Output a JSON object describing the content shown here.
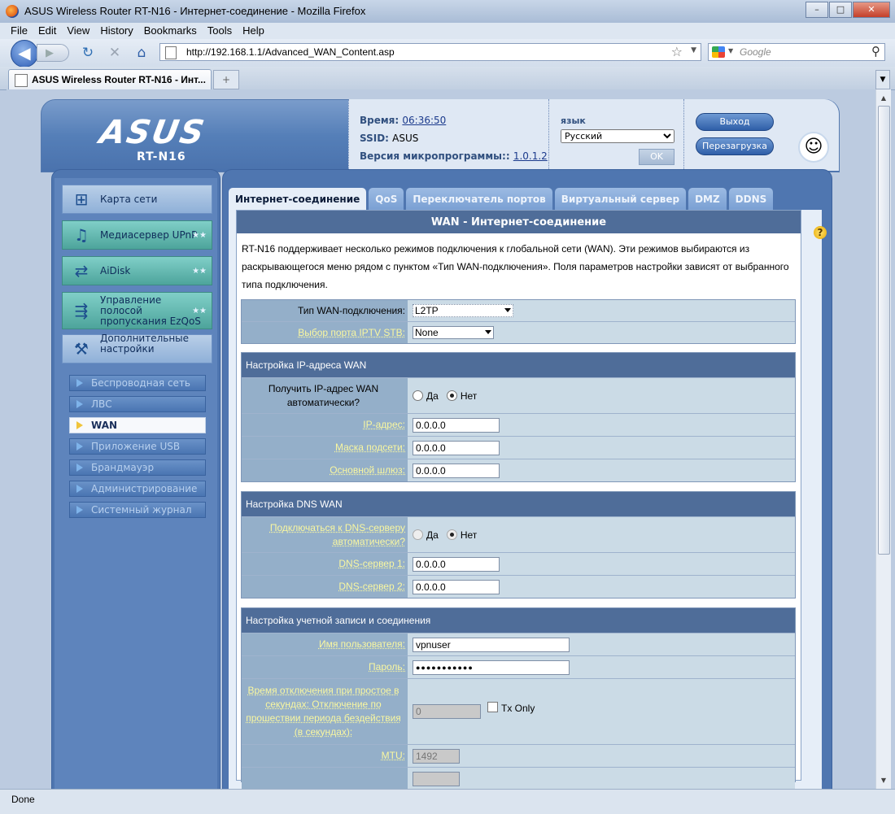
{
  "browser": {
    "window_title": "ASUS Wireless Router RT-N16 - Интернет-соединение - Mozilla Firefox",
    "menu": [
      "File",
      "Edit",
      "View",
      "History",
      "Bookmarks",
      "Tools",
      "Help"
    ],
    "url": "http://192.168.1.1/Advanced_WAN_Content.asp",
    "search_placeholder": "Google",
    "tab_title": "ASUS Wireless Router RT-N16 - Инт...",
    "new_tab": "+",
    "status": "Done"
  },
  "header": {
    "logo": "ASUS",
    "model": "RT-N16",
    "time_label": "Время:",
    "time_value": "06:36:50",
    "ssid_label": "SSID:",
    "ssid_value": "ASUS",
    "fw_label": "Версия микропрограммы::",
    "fw_value": "1.0.1.2",
    "lang_label": "язык",
    "lang_value": "Русский",
    "ok_label": "OK",
    "logout_label": "Выход",
    "reboot_label": "Перезагрузка"
  },
  "sidebar": {
    "menu": [
      {
        "label": "Карта сети",
        "icon": "network-map-icon"
      },
      {
        "label": "Медиасервер UPnP",
        "icon": "media-server-icon"
      },
      {
        "label": "AiDisk",
        "icon": "aidisk-icon"
      },
      {
        "label": "Управление полосой пропускания EzQoS",
        "icon": "ezqos-icon"
      },
      {
        "label": "Дополнительные настройки",
        "icon": "advanced-settings-icon"
      }
    ],
    "stars": "★★",
    "submenu": [
      "Беспроводная сеть",
      "ЛВС",
      "WAN",
      "Приложение USB",
      "Брандмауэр",
      "Администрирование",
      "Системный журнал"
    ],
    "active_submenu": "WAN"
  },
  "tabs": [
    "Интернет-соединение",
    "QoS",
    "Переключатель портов",
    "Виртуальный сервер",
    "DMZ",
    "DDNS"
  ],
  "main": {
    "help_icon": "?",
    "title": "WAN - Интернет-соединение",
    "intro": "RT-N16 поддерживает несколько режимов подключения к глобальной сети (WAN). Эти режимов выбираются из раскрывающегося меню рядом с пунктом «Тип WAN-подключения». Поля параметров настройки зависят от выбранного типа подключения.",
    "wan_type_label": "Тип WAN-подключения:",
    "wan_type_value": "L2TP",
    "iptv_label": "Выбор порта IPTV STB:",
    "iptv_value": "None",
    "ip_section": "Настройка IP-адреса WAN",
    "auto_ip_label": "Получить IP-адрес WAN автоматически?",
    "yes": "Да",
    "no": "Нет",
    "ip_label": "IP-адрес:",
    "ip_value": "0.0.0.0",
    "mask_label": "Маска подсети:",
    "mask_value": "0.0.0.0",
    "gw_label": "Основной шлюз:",
    "gw_value": "0.0.0.0",
    "dns_section": "Настройка DNS WAN",
    "auto_dns_label": "Подключаться к DNS-серверу автоматически?",
    "dns1_label": "DNS-сервер 1:",
    "dns1_value": "0.0.0.0",
    "dns2_label": "DNS-сервер 2:",
    "dns2_value": "0.0.0.0",
    "acct_section": "Настройка учетной записи и соединения",
    "user_label": "Имя пользователя:",
    "user_value": "vpnuser",
    "pass_label": "Пароль:",
    "pass_value": "●●●●●●●●●●●",
    "idle_label": "Время отключения при простое в секундах: Отключение по прошествии периода бездействия (в секундах):",
    "idle_value": "0",
    "tx_only": "Tx Only",
    "mtu_label": "MTU:",
    "mtu_value": "1492"
  }
}
